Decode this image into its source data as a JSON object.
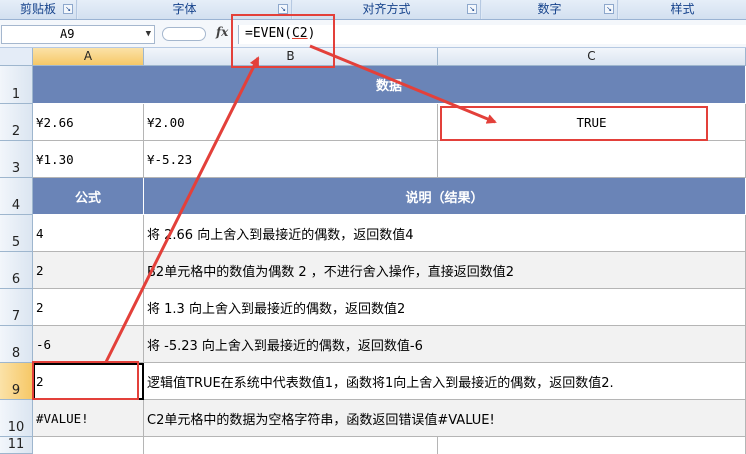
{
  "ribbon": {
    "groups": [
      "剪贴板",
      "字体",
      "对齐方式",
      "数字",
      "样式"
    ]
  },
  "formula_bar": {
    "name_box": "A9",
    "fx_symbol": "fx",
    "formula_prefix": "=EVEN(",
    "formula_arg": "C2",
    "formula_suffix": ")"
  },
  "columns": [
    "A",
    "B",
    "C"
  ],
  "rows": [
    "1",
    "2",
    "3",
    "4",
    "5",
    "6",
    "7",
    "8",
    "9",
    "10",
    "11"
  ],
  "table": {
    "data_header": "数据",
    "data_rows": [
      {
        "a": "¥2.66",
        "b": "¥2.00",
        "c": "TRUE"
      },
      {
        "a": "¥1.30",
        "b": "¥-5.23",
        "c": ""
      }
    ],
    "formula_header": "公式",
    "desc_header": "说明（结果）",
    "result_rows": [
      {
        "result": "4",
        "desc": "将 2.66 向上舍入到最接近的偶数，返回数值4"
      },
      {
        "result": "2",
        "desc": "B2单元格中的数值为偶数 2 ，不进行舍入操作，直接返回数值2"
      },
      {
        "result": "2",
        "desc": "将 1.3 向上舍入到最接近的偶数，返回数值2"
      },
      {
        "result": "-6",
        "desc": "将 -5.23 向上舍入到最接近的偶数，返回数值-6"
      },
      {
        "result": "2",
        "desc": "逻辑值TRUE在系统中代表数值1，函数将1向上舍入到最接近的偶数，返回数值2."
      },
      {
        "result": "#VALUE!",
        "desc": "C2单元格中的数据为空格字符串，函数返回错误值#VALUE!"
      }
    ]
  },
  "colors": {
    "header_fill": "#6a84b7",
    "annotation_red": "#e3403a",
    "shade": "#f2f2f2"
  }
}
